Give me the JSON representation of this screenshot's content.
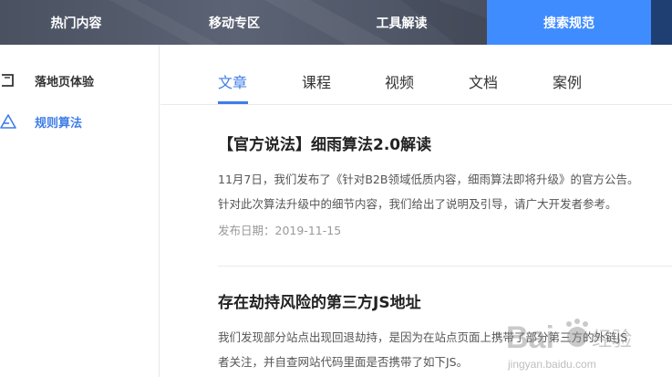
{
  "topnav": {
    "items": [
      {
        "label": "热门内容"
      },
      {
        "label": "移动专区"
      },
      {
        "label": "工具解读"
      },
      {
        "label": "搜索规范"
      }
    ],
    "active_color": "#3f8cff"
  },
  "sidebar": {
    "items": [
      {
        "label": "落地页体验",
        "icon": "page-icon"
      },
      {
        "label": "规则算法",
        "icon": "warning-triangle-icon",
        "active": true
      }
    ],
    "active_color": "#3f7de8"
  },
  "tabs": {
    "items": [
      {
        "label": "文章",
        "active": true
      },
      {
        "label": "课程"
      },
      {
        "label": "视频"
      },
      {
        "label": "文档"
      },
      {
        "label": "案例"
      }
    ]
  },
  "articles": [
    {
      "title": "【官方说法】细雨算法2.0解读",
      "summary_line1": "11月7日，我们发布了《针对B2B领域低质内容，细雨算法即将升级》的官方公告。",
      "summary_line2": "针对此次算法升级中的细节内容，我们给出了说明及引导，请广大开发者参考。",
      "date": "发布日期：2019-11-15"
    },
    {
      "title": "存在劫持风险的第三方JS地址",
      "summary_line1": "我们发现部分站点出现回退劫持，是因为在站点页面上携带了部分第三方的外链JS",
      "summary_line2": "者关注，并自查网站代码里面是否携带了如下JS。"
    }
  ],
  "watermark": {
    "logo_text": "Bai",
    "logo_suffix": "经验",
    "url": "jingyan.baidu.com"
  }
}
